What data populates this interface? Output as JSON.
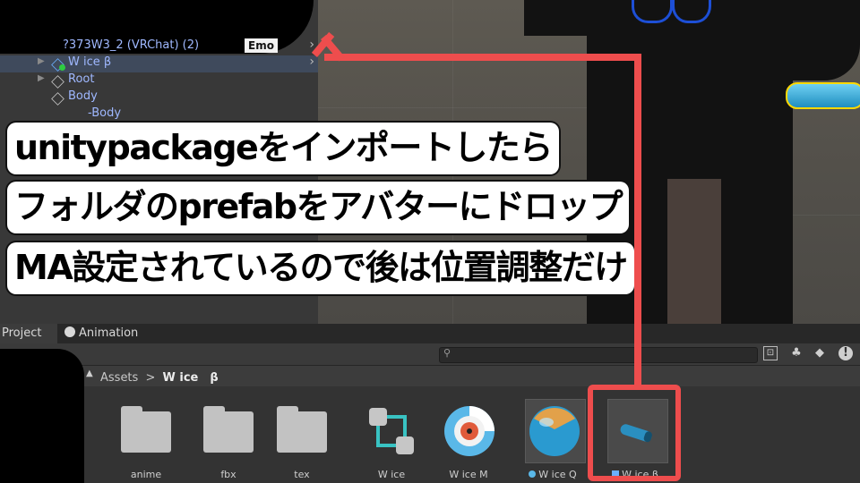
{
  "hierarchy": {
    "avatar_row": "?373W3_2 (VRChat) (2)",
    "emo_badge": "Emo",
    "items": [
      {
        "label": "W ice β"
      },
      {
        "label": "Root"
      },
      {
        "label": "Body"
      },
      {
        "label": "-Body"
      }
    ]
  },
  "caption": {
    "line1": "unitypackageをインポートしたら",
    "line2": "フォルダのprefabをアバターにドロップ",
    "line3": "MA設定されているので後は位置調整だけ"
  },
  "tabs": {
    "project": "Project",
    "animation": "Animation"
  },
  "breadcrumb": {
    "root": "Assets",
    "separator": ">",
    "current": "W ice　β"
  },
  "assets": [
    {
      "label": "anime",
      "icon": "folder-icon"
    },
    {
      "label": "fbx",
      "icon": "folder-icon"
    },
    {
      "label": "tex",
      "icon": "folder-icon"
    },
    {
      "label": "W ice",
      "icon": "animator-controller-icon"
    },
    {
      "label": "W ice M",
      "icon": "material-icon"
    },
    {
      "label": "W ice Q",
      "icon": "material-sphere-icon"
    },
    {
      "label": "W ice β",
      "icon": "prefab-icon"
    }
  ],
  "colors": {
    "annotation_red": "#ee4d4d",
    "hierarchy_blue": "#9fb8ff"
  }
}
